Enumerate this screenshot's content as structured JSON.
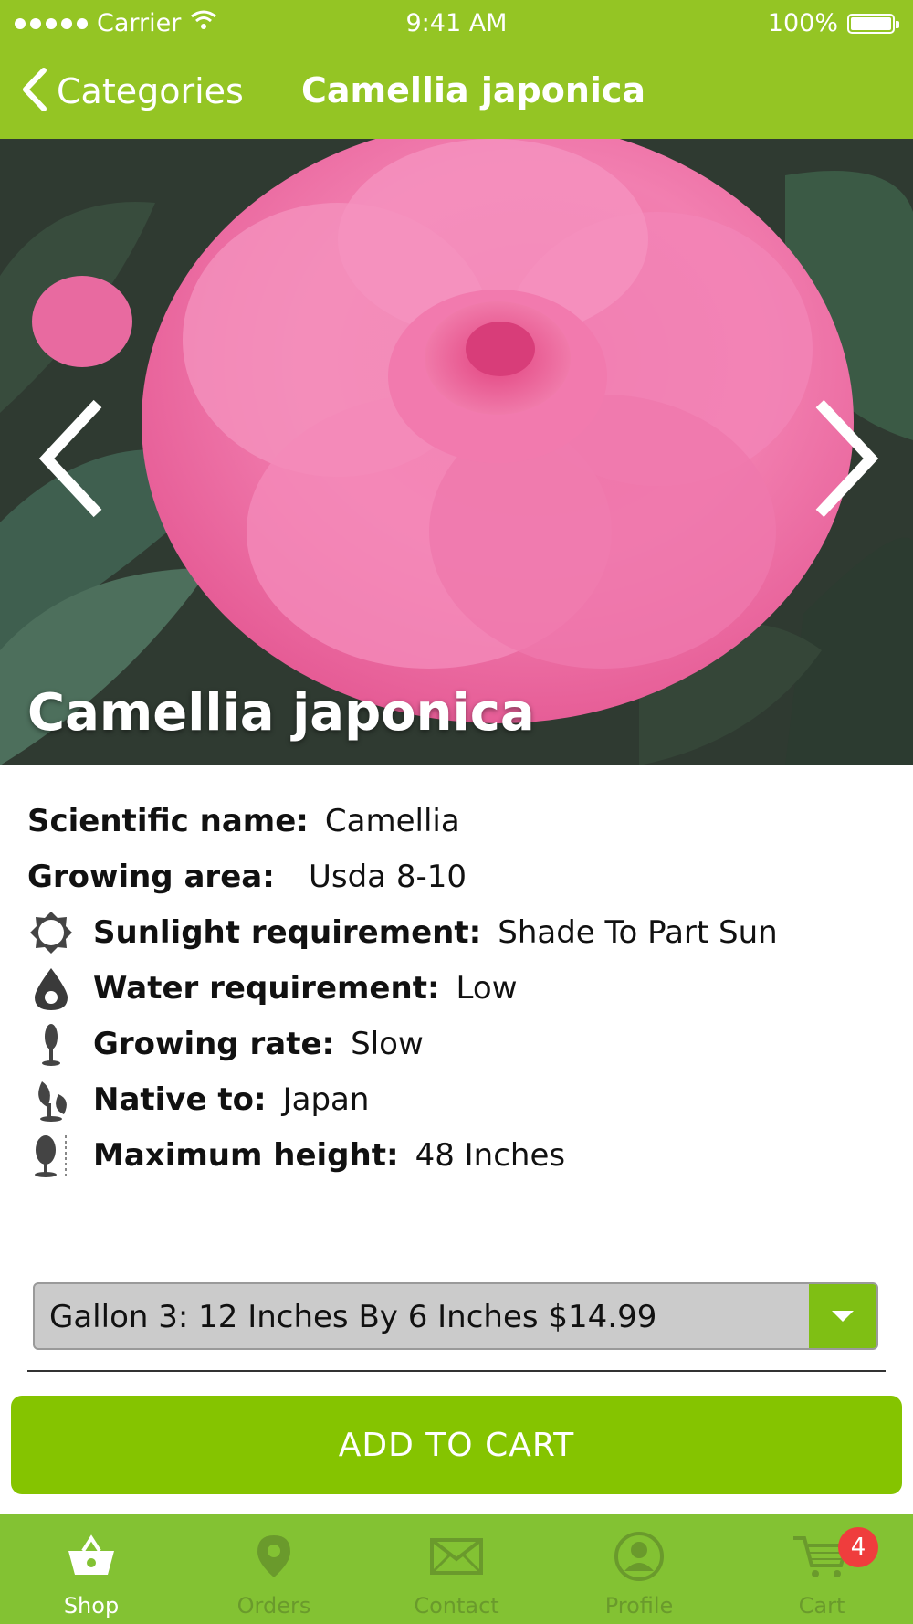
{
  "status_bar": {
    "carrier": "Carrier",
    "time": "9:41 AM",
    "battery": "100%"
  },
  "nav": {
    "back_label": "Categories",
    "title": "Camellia japonica"
  },
  "hero": {
    "title": "Camellia japonica"
  },
  "details": {
    "scientific_name_label": "Scientific name:",
    "scientific_name_value": "Camellia",
    "growing_area_label": "Growing area:",
    "growing_area_value": "Usda 8-10",
    "sunlight_label": "Sunlight requirement:",
    "sunlight_value": "Shade To Part Sun",
    "water_label": "Water requirement:",
    "water_value": "Low",
    "growing_rate_label": "Growing rate:",
    "growing_rate_value": "Slow",
    "native_label": "Native to:",
    "native_value": "Japan",
    "max_height_label": "Maximum height:",
    "max_height_value": "48 Inches"
  },
  "size_select": {
    "selected": "Gallon 3: 12 Inches By 6 Inches $14.99"
  },
  "add_to_cart_label": "ADD TO CART",
  "tabs": [
    {
      "label": "Shop",
      "icon": "basket-icon"
    },
    {
      "label": "Orders",
      "icon": "location-pin-icon"
    },
    {
      "label": "Contact",
      "icon": "envelope-icon"
    },
    {
      "label": "Profile",
      "icon": "user-icon"
    },
    {
      "label": "Cart",
      "icon": "cart-icon",
      "badge": "4"
    }
  ],
  "colors": {
    "brand_green": "#94c524",
    "button_green": "#85c400",
    "tabbar_green": "#83c233",
    "badge_red": "#ef3d3d"
  }
}
